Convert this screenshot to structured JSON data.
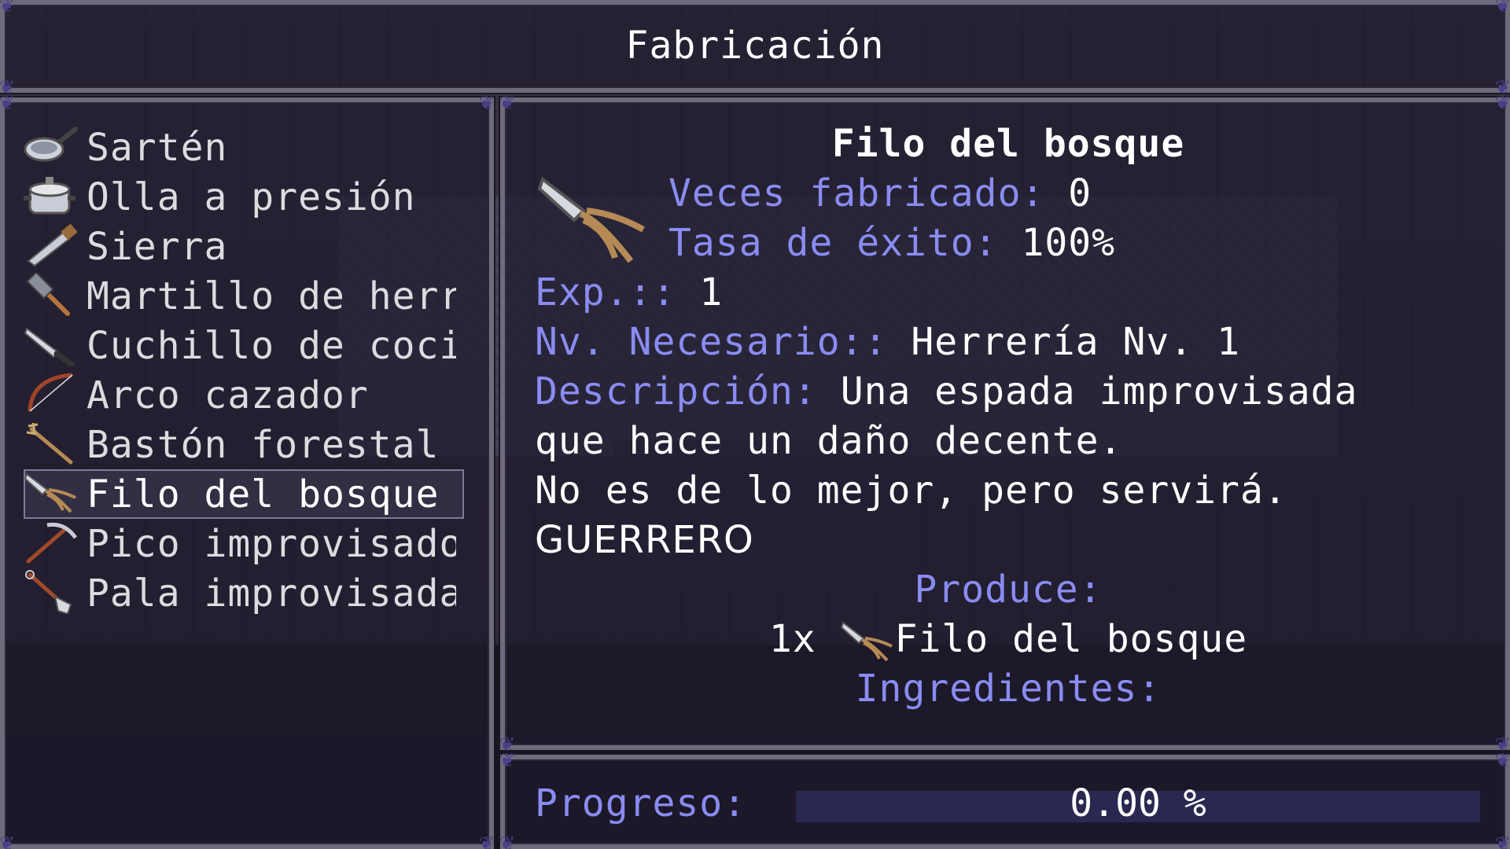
{
  "title": "Fabricación",
  "recipes": [
    {
      "label": "Sartén",
      "icon": "frying-pan-icon"
    },
    {
      "label": "Olla a presión",
      "icon": "pressure-pot-icon"
    },
    {
      "label": "Sierra",
      "icon": "saw-icon"
    },
    {
      "label": "Martillo de herrero",
      "icon": "hammer-icon"
    },
    {
      "label": "Cuchillo de cocina",
      "icon": "knife-icon"
    },
    {
      "label": "Arco cazador",
      "icon": "bow-icon"
    },
    {
      "label": "Bastón forestal",
      "icon": "staff-icon"
    },
    {
      "label": "Filo del bosque",
      "icon": "forest-blade-icon",
      "selected": true
    },
    {
      "label": "Pico improvisado",
      "icon": "pickaxe-icon"
    },
    {
      "label": "Pala improvisada",
      "icon": "shovel-icon"
    }
  ],
  "detail": {
    "name": "Filo del bosque",
    "icon": "forest-blade-icon",
    "times_crafted_label": "Veces fabricado:",
    "times_crafted_value": "0",
    "success_rate_label": "Tasa de éxito:",
    "success_rate_value": "100%",
    "exp_label": "Exp.::",
    "exp_value": "1",
    "level_label": "Nv. Necesario::",
    "level_value": "Herrería Nv. 1",
    "description_label": "Descripción:",
    "description_line1": "Una espada improvisada",
    "description_line2": "que hace un daño decente.",
    "description_line3": "No es de lo mejor, pero servirá.",
    "class_tag": "GUERRERO",
    "produce_label": "Produce:",
    "produce_qty": "1x",
    "produce_item": "Filo del bosque",
    "ingredients_label": "Ingredientes:"
  },
  "progress": {
    "label": "Progreso:",
    "value_text": "0.00 %",
    "fraction": 0.0
  },
  "colors": {
    "key_text": "#8a8cf2",
    "value_text": "#ffffff",
    "window_border": "#6f6a7c",
    "progress_track": "#2a2850"
  }
}
